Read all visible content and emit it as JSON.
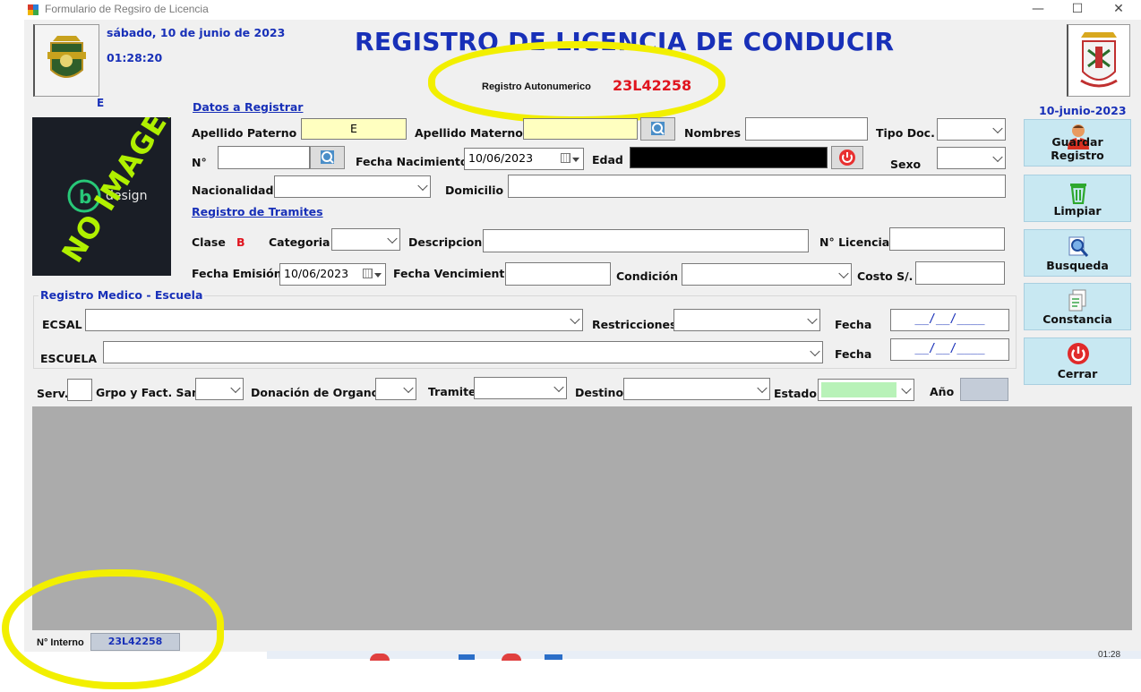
{
  "window": {
    "title": "Formulario de Regsiro de Licencia",
    "minimize": "—",
    "maximize": "☐",
    "close": "✕"
  },
  "header": {
    "date_long": "sábado, 10 de junio de 2023",
    "time": "01:28:20",
    "title": "REGISTRO DE LICENCIA DE CONDUCIR",
    "autonum_label": "Registro Autonumerico",
    "autonum_value": "23L42258",
    "left_small_letter": "E",
    "date_short": "10-junio-2023"
  },
  "photo": {
    "watermark": "NO IMAGEN",
    "brand": "design"
  },
  "datos": {
    "section_label": "Datos a Registrar",
    "apellido_paterno_label": "Apellido Paterno",
    "apellido_paterno_value": "E",
    "apellido_materno_label": "Apellido Materno",
    "nombres_label": "Nombres",
    "tipo_doc_label": "Tipo Doc.",
    "numero_label": "N°",
    "fecha_nacimiento_label": "Fecha Nacimiento",
    "fecha_nacimiento_value": "10/06/2023",
    "edad_label": "Edad",
    "sexo_label": "Sexo",
    "nacionalidad_label": "Nacionalidad",
    "domicilio_label": "Domicilio"
  },
  "tramites": {
    "section_label": "Registro de Tramites",
    "clase_label": "Clase",
    "clase_value": "B",
    "categoria_label": "Categoria",
    "descripcion_label": "Descripcion",
    "n_licencia_label": "N° Licencia",
    "fecha_emision_label": "Fecha Emisión",
    "fecha_emision_value": "10/06/2023",
    "fecha_vencimiento_label": "Fecha Vencimiento",
    "condicion_label": "Condición",
    "costo_label": "Costo S/."
  },
  "medico": {
    "section_label": "Registro Medico - Escuela",
    "ecsal_label": "ECSAL",
    "restricciones_label": "Restricciones",
    "fecha_label": "Fecha",
    "fecha_mask": "__/__/____",
    "escuela_label": "ESCUELA",
    "fecha2_label": "Fecha",
    "fecha2_mask": "__/__/____"
  },
  "bottom": {
    "serv_label": "Serv.",
    "grupo_label": "Grpo y Fact. Sang.",
    "donacion_label": "Donación de Organos",
    "tramite_label": "Tramite",
    "destino_label": "Destino",
    "estado_label": "Estado",
    "anio_label": "Año"
  },
  "footer": {
    "interno_label": "N° Interno",
    "interno_value": "23L42258",
    "taskbar_time": "01:28"
  },
  "buttons": {
    "guardar": "Guardar Registro",
    "limpiar": "Limpiar",
    "busqueda": "Busqueda",
    "constancia": "Constancia",
    "cerrar": "Cerrar"
  },
  "colors": {
    "title_blue": "#1830b8",
    "highlight_yellow": "#f2ef00",
    "autonum_red": "#e0141e",
    "estado_green": "#b8f2b8",
    "anio_gray": "#c4ccd8",
    "paterno_yellow": "#ffffc0"
  }
}
